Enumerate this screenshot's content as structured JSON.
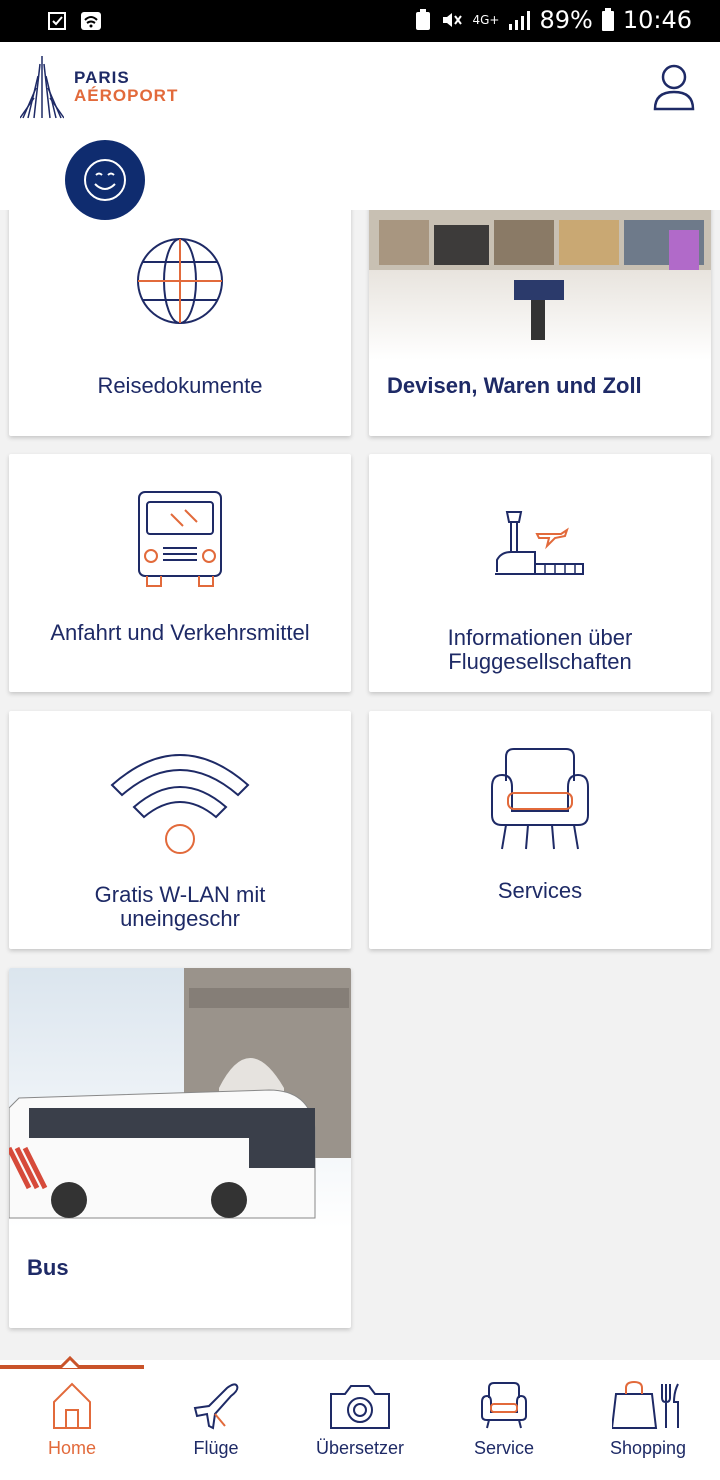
{
  "status_bar": {
    "battery": "89%",
    "time": "10:46",
    "network": "4G+"
  },
  "header": {
    "logo_line1": "PARIS",
    "logo_line2": "AÉROPORT"
  },
  "cards": [
    {
      "label": "Reisedokumente",
      "icon": "globe-icon"
    },
    {
      "label": "Devisen, Waren und Zoll",
      "icon": "shopping-mall-image"
    },
    {
      "label": "Anfahrt und Verkehrsmittel",
      "icon": "bus-front-icon"
    },
    {
      "label_line1": "Informationen über",
      "label_line2": "Fluggesellschaften",
      "icon": "airport-tower-icon"
    },
    {
      "label_line1": "Gratis W-LAN mit",
      "label_line2": "uneingeschr",
      "icon": "wifi-icon"
    },
    {
      "label": "Services",
      "icon": "armchair-icon"
    },
    {
      "label": "Bus",
      "icon": "bus-photo-image"
    }
  ],
  "colors": {
    "navy": "#1e2a66",
    "accent": "#e26a3b",
    "smiley_bg": "#0f2c6f"
  },
  "bottom_nav": [
    {
      "label": "Home",
      "icon": "home-icon",
      "active": true
    },
    {
      "label": "Flüge",
      "icon": "airplane-icon"
    },
    {
      "label": "Übersetzer",
      "icon": "camera-icon"
    },
    {
      "label": "Service",
      "icon": "armchair-icon"
    },
    {
      "label": "Shopping",
      "icon": "shopping-bag-icon"
    }
  ]
}
